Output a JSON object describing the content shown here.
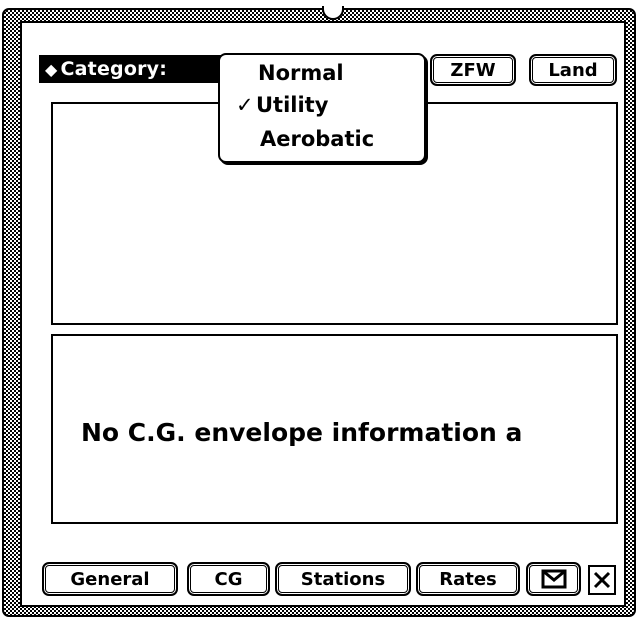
{
  "header": {
    "category_label": "Category:",
    "zfw_label": "ZFW",
    "land_label": "Land"
  },
  "category_menu": {
    "items": [
      {
        "label": "Normal",
        "checked": false
      },
      {
        "label": "Utility",
        "checked": true
      },
      {
        "label": "Aerobatic",
        "checked": false
      }
    ],
    "check_glyph": "✓"
  },
  "envelope": {
    "message": "No C.G. envelope information a"
  },
  "footer": {
    "buttons": [
      "General",
      "CG",
      "Stations",
      "Rates"
    ],
    "mail_icon": "envelope-icon",
    "close_icon": "close-box-icon"
  }
}
